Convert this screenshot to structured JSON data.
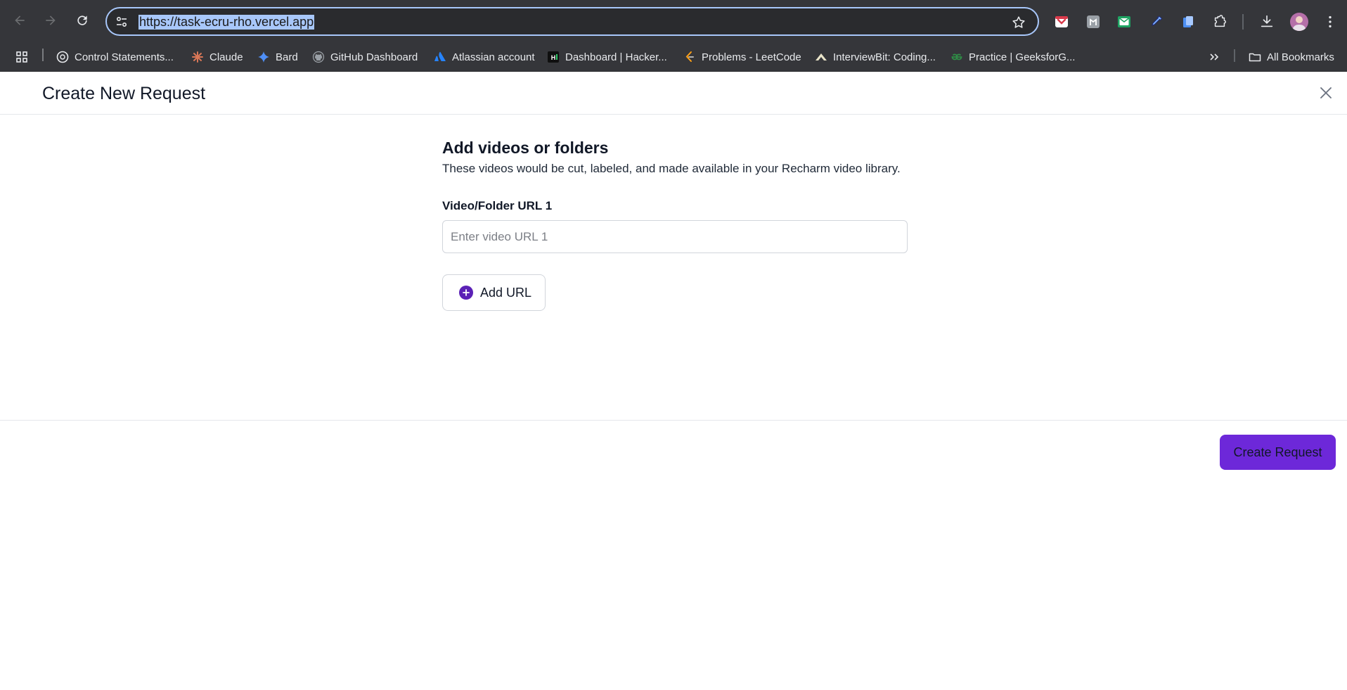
{
  "browser": {
    "url": "https://task-ecru-rho.vercel.app",
    "bookmarks": [
      {
        "label": "Control Statements...",
        "icon": "openai-icon"
      },
      {
        "label": "Claude",
        "icon": "claude-icon"
      },
      {
        "label": "Bard",
        "icon": "bard-sparkle-icon"
      },
      {
        "label": "GitHub Dashboard",
        "icon": "github-icon"
      },
      {
        "label": "Atlassian account",
        "icon": "atlassian-icon"
      },
      {
        "label": "Dashboard | Hacker...",
        "icon": "hackerrank-icon"
      },
      {
        "label": "Problems - LeetCode",
        "icon": "leetcode-icon"
      },
      {
        "label": "InterviewBit: Coding...",
        "icon": "interviewbit-icon"
      },
      {
        "label": "Practice | GeeksforG...",
        "icon": "geeksforgeeks-icon"
      }
    ],
    "all_bookmarks_label": "All Bookmarks"
  },
  "page": {
    "title": "Create New Request",
    "section_title": "Add videos or folders",
    "section_desc": "These videos would be cut, labeled, and made available in your Recharm video library.",
    "field_label": "Video/Folder URL 1",
    "field_placeholder": "Enter video URL 1",
    "field_value": "",
    "add_url_label": "Add URL",
    "create_label": "Create Request"
  },
  "colors": {
    "accent": "#6d28d9",
    "plus_icon": "#5b21b6",
    "chrome_bg": "#35363a",
    "url_highlight": "#a8c7fa"
  }
}
